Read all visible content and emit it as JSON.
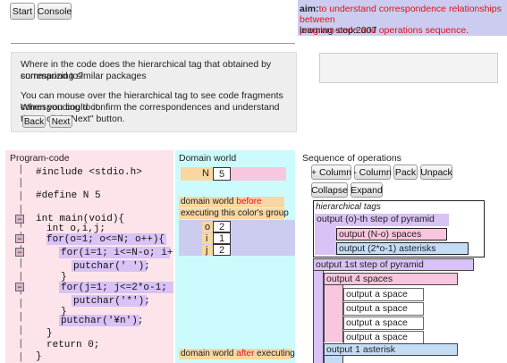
{
  "toolbar": {
    "start_label": "Start",
    "console_label": "Console"
  },
  "aim": {
    "label": "aim:",
    "text_line1": "to understand correspondence relationships between",
    "text_line2": "program-code and operations sequence.",
    "learning_step": "learning step:2007"
  },
  "instructions": {
    "question_line1": "Where in the code does the hierarchical tag that obtained by summarizing similar packages",
    "question_line2": "correspond to?",
    "hint_line1": "You can mouse over the hierarchical tag to see code fragments corresponding to it.",
    "hint_line2": "When you could confirm the correspondences and understand them, click \"Next\" button.",
    "back_label": "Back",
    "next_label": "Next"
  },
  "program_code": {
    "title": "Program-code",
    "lines": [
      "#include <stdio.h>",
      "#define N 5",
      "int main(void){",
      "int o,i,j;",
      "for(o=1; o<=N; o++){",
      "for(i=1; i<=N-o; i++){",
      "putchar(' ');",
      "}",
      "for(j=1; j<=2*o-1; j++){",
      "putchar('*');",
      "}",
      "putchar('¥n');",
      "}",
      "return 0;",
      "}"
    ],
    "fold_glyph": "−"
  },
  "domain_world": {
    "title": "Domain world",
    "n_label": "N",
    "n_value": "5",
    "before_pre": "domain world ",
    "before_word": "before",
    "before_line2": "executing this color's group",
    "vars": [
      {
        "name": "o",
        "value": "2"
      },
      {
        "name": "i",
        "value": "1"
      },
      {
        "name": "j",
        "value": "2"
      }
    ],
    "after_pre": "domain world ",
    "after_word": "after",
    "after_post": " executing"
  },
  "operations": {
    "title": "Sequence of operations",
    "buttons": [
      "+ Column",
      "- Column",
      "Pack",
      "Unpack",
      "Collapse",
      "Expand"
    ],
    "hierarchical_label": "hierarchical tags",
    "tags": [
      "output (o)-th step of pyramid",
      "output (N-o) spaces",
      "output (2*o-1) asterisks"
    ],
    "steps": [
      "output 1st step of pyramid",
      "output 4 spaces",
      "output a space",
      "output a space",
      "output a space",
      "output a space",
      "output 1 asterisk"
    ]
  },
  "colors": {
    "aim_bg": "#ccccf0",
    "aim_text": "#e0121c",
    "program_bg": "#fce4ea",
    "domain_bg": "#ccfbfd",
    "highlight_purple": "#d9c2f5",
    "tag_pink": "#f9c6df",
    "tag_blue": "#c5dcf5"
  }
}
